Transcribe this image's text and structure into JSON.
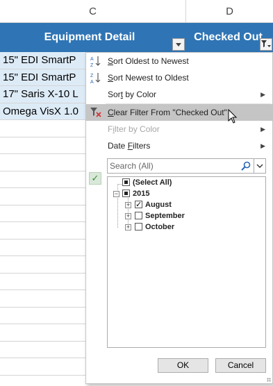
{
  "columns": {
    "c": "C",
    "d": "D"
  },
  "table_header": {
    "equipment_detail": "Equipment Detail",
    "checked_out": "Checked Out"
  },
  "rows": [
    "15\" EDI SmartP",
    "15\" EDI SmartP",
    "17\" Saris X-10 L",
    "Omega VisX 1.0"
  ],
  "menu": {
    "sort_oldest_prefix": "S",
    "sort_oldest_rest": "ort Oldest to Newest",
    "sort_newest_prefix": "S",
    "sort_newest_rest": "ort Newest to Oldest",
    "sort_by_color_prefix": "Sor",
    "sort_by_color_ul": "t",
    "sort_by_color_rest": " by Color",
    "clear_filter_ul": "C",
    "clear_filter_rest": "lear Filter From \"Checked Out\"",
    "filter_by_color_prefix": "F",
    "filter_by_color_ul": "i",
    "filter_by_color_rest": "lter by Color",
    "date_filters_prefix": "Date ",
    "date_filters_ul": "F",
    "date_filters_rest": "ilters"
  },
  "search": {
    "placeholder": "Search (All)"
  },
  "tree": {
    "select_all": "(Select All)",
    "year": "2015",
    "months": [
      {
        "label": "August",
        "checked": true
      },
      {
        "label": "September",
        "checked": false
      },
      {
        "label": "October",
        "checked": false
      }
    ]
  },
  "buttons": {
    "ok": "OK",
    "cancel": "Cancel"
  },
  "colors": {
    "table_header": "#2f75b5",
    "row_band": "#ddebf7",
    "hover": "#c5c5c5"
  }
}
